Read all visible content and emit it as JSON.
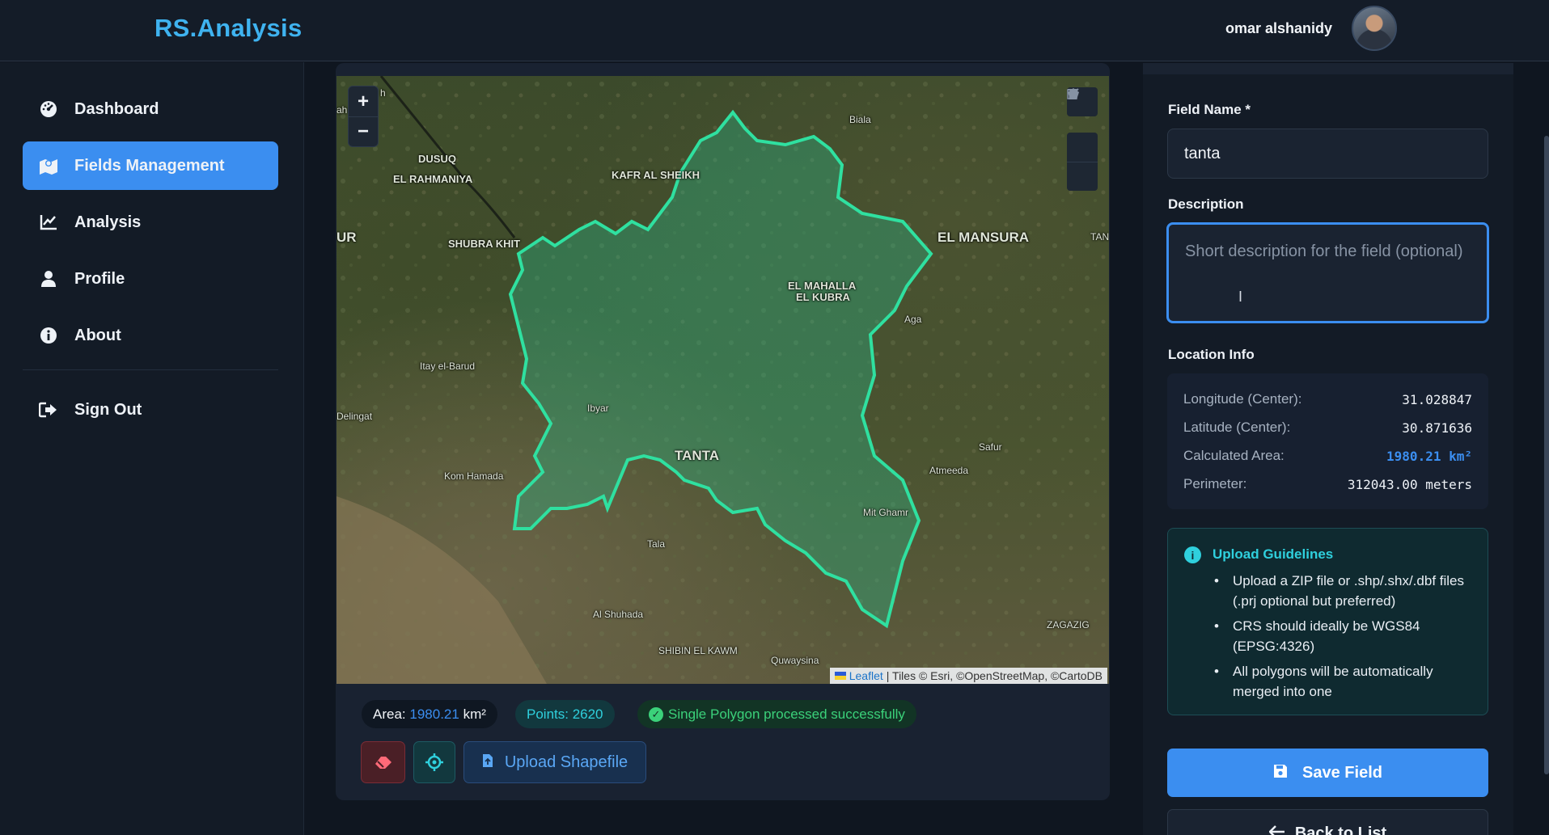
{
  "header": {
    "brand": "RS.Analysis",
    "user_name": "omar alshanidy"
  },
  "sidebar": {
    "items": [
      {
        "label": "Dashboard",
        "icon": "gauge-icon",
        "active": false
      },
      {
        "label": "Fields Management",
        "icon": "map-icon",
        "active": true
      },
      {
        "label": "Analysis",
        "icon": "chart-line-icon",
        "active": false
      },
      {
        "label": "Profile",
        "icon": "user-icon",
        "active": false
      },
      {
        "label": "About",
        "icon": "info-icon",
        "active": false
      }
    ],
    "sign_out": {
      "label": "Sign Out",
      "icon": "sign-out-icon"
    }
  },
  "map": {
    "zoom_in": "+",
    "zoom_out": "−",
    "labels": {
      "dusuq": "DUSUQ",
      "el_rahmaniya": "EL RAHMANIYA",
      "kafr_al_sheikh": "KAFR AL SHEIKH",
      "biala": "Biala",
      "el_mansura": "EL MANSURA",
      "shubra_khit": "SHUBRA KHIT",
      "el_mahalla": "EL MAHALLA",
      "el_kubra": "EL KUBRA",
      "aga": "Aga",
      "itay_el_barud": "Itay el-Barud",
      "ibyar": "Ibyar",
      "tanta": "TANTA",
      "delingat": "Delingat",
      "kom_hamada": "Kom Hamada",
      "safur": "Safur",
      "atmeeda": "Atmeeda",
      "mit_ghamr": "Mit Ghamr",
      "tala": "Tala",
      "al_shuhada": "Al Shuhada",
      "shibin_el_kawm": "SHIBIN EL KAWM",
      "quwaysina": "Quwaysina",
      "zagazig": "ZAGAZIG",
      "edge_left_ur": "UR",
      "edge_right_tan": "TAN",
      "edge_top_left": "ah",
      "edge_top_left2": "h"
    },
    "attribution_link": "Leaflet",
    "attribution_text": "| Tiles © Esri, ©OpenStreetMap, ©CartoDB"
  },
  "stats": {
    "area_label": "Area:",
    "area_value": "1980.21",
    "area_unit": "km²",
    "points": "Points: 2620",
    "status": "Single Polygon processed successfully"
  },
  "actions": {
    "upload_label": "Upload Shapefile"
  },
  "form": {
    "field_name_label": "Field Name *",
    "field_name_value": "tanta",
    "description_label": "Description",
    "description_placeholder": "Short description for the field (optional)",
    "location_label": "Location Info",
    "location": [
      {
        "key": "Longitude (Center):",
        "value": "31.028847"
      },
      {
        "key": "Latitude (Center):",
        "value": "30.871636"
      },
      {
        "key": "Calculated Area:",
        "value": "1980.21 km²"
      },
      {
        "key": "Perimeter:",
        "value": "312043.00 meters"
      }
    ],
    "guidelines_title": "Upload Guidelines",
    "guidelines": [
      "Upload a ZIP file or .shp/.shx/.dbf files (.prj optional but preferred)",
      "CRS should ideally be WGS84 (EPSG:4326)",
      "All polygons will be automatically merged into one"
    ],
    "save_label": "Save Field",
    "back_label": "Back to List"
  },
  "colors": {
    "accent": "#3b8ef0",
    "brand": "#3fb3f0",
    "polygon_stroke": "#2fe0a0",
    "success": "#3bd17a",
    "cyan": "#2fd0dd"
  }
}
